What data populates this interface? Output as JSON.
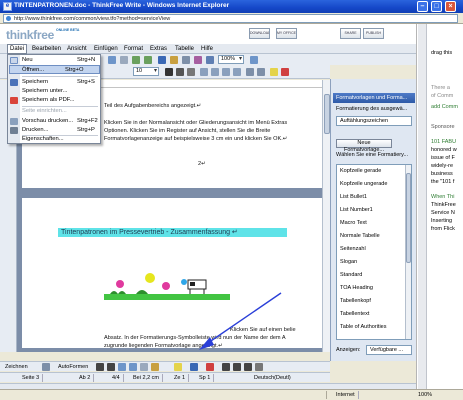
{
  "window": {
    "title": "TINTENPATRONEN.doc - ThinkFree Write - Windows Internet Explorer",
    "url": "http://www.thinkfree.com/common/view.tfo?method=serviceView"
  },
  "app": {
    "logo": "thinkfree",
    "logo_tag": "ONLINE BETA",
    "header_buttons": [
      "DOWNLOAD",
      "MY OFFICE",
      "SHARE",
      "PUBLISH"
    ]
  },
  "menubar": [
    "Datei",
    "Bearbeiten",
    "Ansicht",
    "Einfügen",
    "Format",
    "Extras",
    "Tabelle",
    "Hilfe"
  ],
  "file_menu": {
    "items": [
      {
        "label": "Neu",
        "shortcut": "Strg+N",
        "state": "normal"
      },
      {
        "label": "Öffnen...",
        "shortcut": "Strg+O",
        "state": "highlight"
      },
      {
        "label": "Speichern",
        "shortcut": "Strg+S",
        "state": "normal"
      },
      {
        "label": "Speichern unter...",
        "shortcut": "",
        "state": "normal"
      },
      {
        "label": "Speichern als PDF...",
        "shortcut": "",
        "state": "normal"
      },
      {
        "label": "Seite einrichten...",
        "shortcut": "",
        "state": "disabled"
      },
      {
        "label": "Vorschau drucken...",
        "shortcut": "Strg+F2",
        "state": "normal"
      },
      {
        "label": "Drucken...",
        "shortcut": "Strg+P",
        "state": "normal"
      },
      {
        "label": "Eigenschaften...",
        "shortcut": "",
        "state": "normal"
      }
    ]
  },
  "toolbar": {
    "font_size": "10",
    "zoom": "100%"
  },
  "document": {
    "page1_lines": [
      "Teil des Aufgabenbereichs angezeigt.↵",
      "Klicken Sie in der Normalansicht oder Gliederungsansicht im Menü Extras",
      "Optionen. Klicken Sie im Register auf Ansicht, stellen Sie die Breite",
      "Formatvorlagenanzeige auf beispielsweise 3 cm ein und klicken Sie OK.↵"
    ],
    "page1_number": "2↵",
    "heading": "Tintenpatronen im Pressevertrieb - Zusammenfassung ↵",
    "page2_lines": [
      "Klicken Sie auf einen belie",
      "Absatz. In der Formatierungs-Symbolleiste wird nun der Name der dem A",
      "zugrunde liegenden Formatvorlage angezeigt.↵"
    ]
  },
  "panel": {
    "title": "Formatvorlagen und Forma...",
    "format_label": "Formatierung des ausgewä...",
    "current_style": "Auftählungszeichen",
    "new_style_button": "Neue Formatvorlage...",
    "choose_label": "Wählen Sie eine Formatiery...",
    "styles": [
      "Kopfzeile gerade",
      "Kopfzeile ungerade",
      "List Bullet1",
      "List Number1",
      "Macro Text",
      "Normale Tabelle",
      "Seitenzahl",
      "Slogan",
      "Standard",
      "TOA Heading",
      "Tabellenkopf",
      "Tabellentext",
      "Table of Authorities"
    ],
    "show_label": "Anzeigen:",
    "show_value": "Verfügbare ..."
  },
  "drawbar": {
    "draw_label": "Zeichnen",
    "autoforms_label": "AutoFormen"
  },
  "status": {
    "page": "Seite 3",
    "section": "Ab 2",
    "pages": "4/4",
    "position": "Bei 2,2 cm",
    "line": "Ze 1",
    "column": "Sp 1",
    "language": "Deutsch(Deutl)"
  },
  "ie_status": {
    "zone": "Internet",
    "zoom": "100%"
  },
  "web_sidebar": {
    "lines": [
      "drag this",
      "There a",
      "of Comm",
      "add Comm",
      "Sponsore",
      "101 FABU",
      "honored w",
      "issue of F",
      "widely-re",
      "business",
      "the \"101 f",
      "When Thi",
      "ThinkFree",
      "Service N",
      "Inserting",
      "from Flick"
    ]
  },
  "colors": {
    "titlebar": "#1547c8",
    "heading_highlight": "#5fe3e8",
    "panel_header": "#2e5aa7",
    "doc_background": "#7c8da8"
  }
}
